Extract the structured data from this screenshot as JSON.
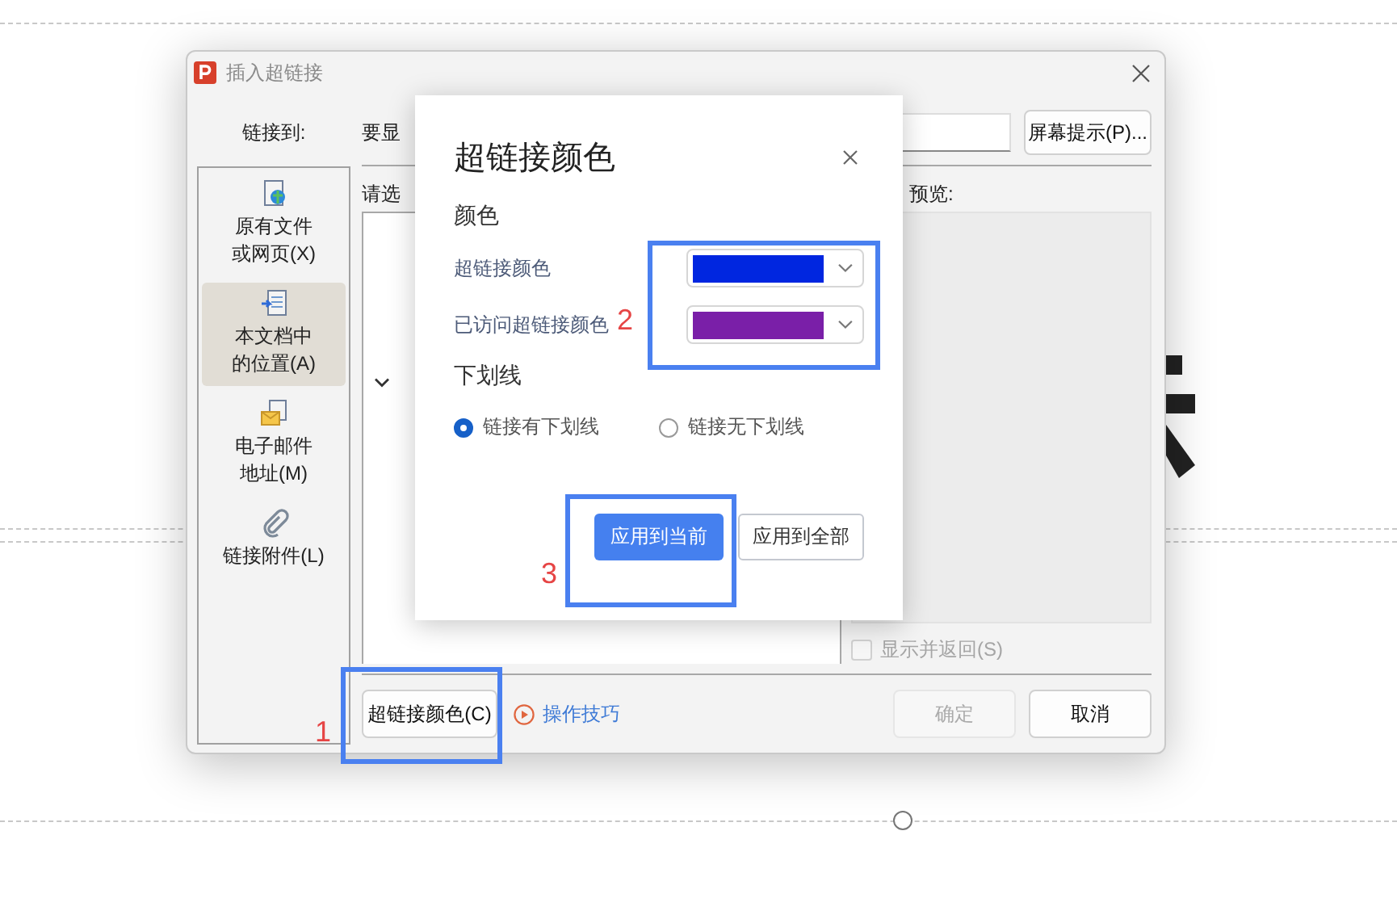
{
  "dialog": {
    "title": "插入超链接",
    "link_to_label": "链接到:",
    "display_text_label": "要显",
    "screen_tip_button": "屏幕提示(P)...",
    "sidebar": [
      {
        "kind": "file",
        "lines": [
          "原有文件",
          "或网页(X)"
        ],
        "selected": false
      },
      {
        "kind": "document",
        "lines": [
          "本文档中",
          "的位置(A)"
        ],
        "selected": true
      },
      {
        "kind": "email",
        "lines": [
          "电子邮件",
          "地址(M)"
        ],
        "selected": false
      },
      {
        "kind": "attachment",
        "lines": [
          "链接附件(L)"
        ],
        "selected": false
      }
    ],
    "select_label": "请选",
    "preview_label": "预览:",
    "show_and_return": {
      "label": "显示并返回(S)",
      "checked": false,
      "disabled": true
    },
    "color_button": "超链接颜色(C)",
    "tips_link": "操作技巧",
    "ok_button": {
      "label": "确定",
      "disabled": true
    },
    "cancel_button": {
      "label": "取消",
      "disabled": false
    }
  },
  "color_popup": {
    "title": "超链接颜色",
    "color_section": "颜色",
    "colors": [
      {
        "label": "超链接颜色",
        "color": "#0026e0"
      },
      {
        "label": "已访问超链接颜色",
        "color": "#7a1fa8"
      }
    ],
    "underline_section": "下划线",
    "underline_options": [
      {
        "label": "链接有下划线",
        "selected": true
      },
      {
        "label": "链接无下划线",
        "selected": false
      }
    ],
    "buttons": [
      {
        "label": "应用到当前",
        "kind": "primary"
      },
      {
        "label": "应用到全部",
        "kind": "secondary"
      }
    ]
  },
  "annotations": [
    {
      "label": "1"
    },
    {
      "label": "2"
    },
    {
      "label": "3"
    }
  ]
}
